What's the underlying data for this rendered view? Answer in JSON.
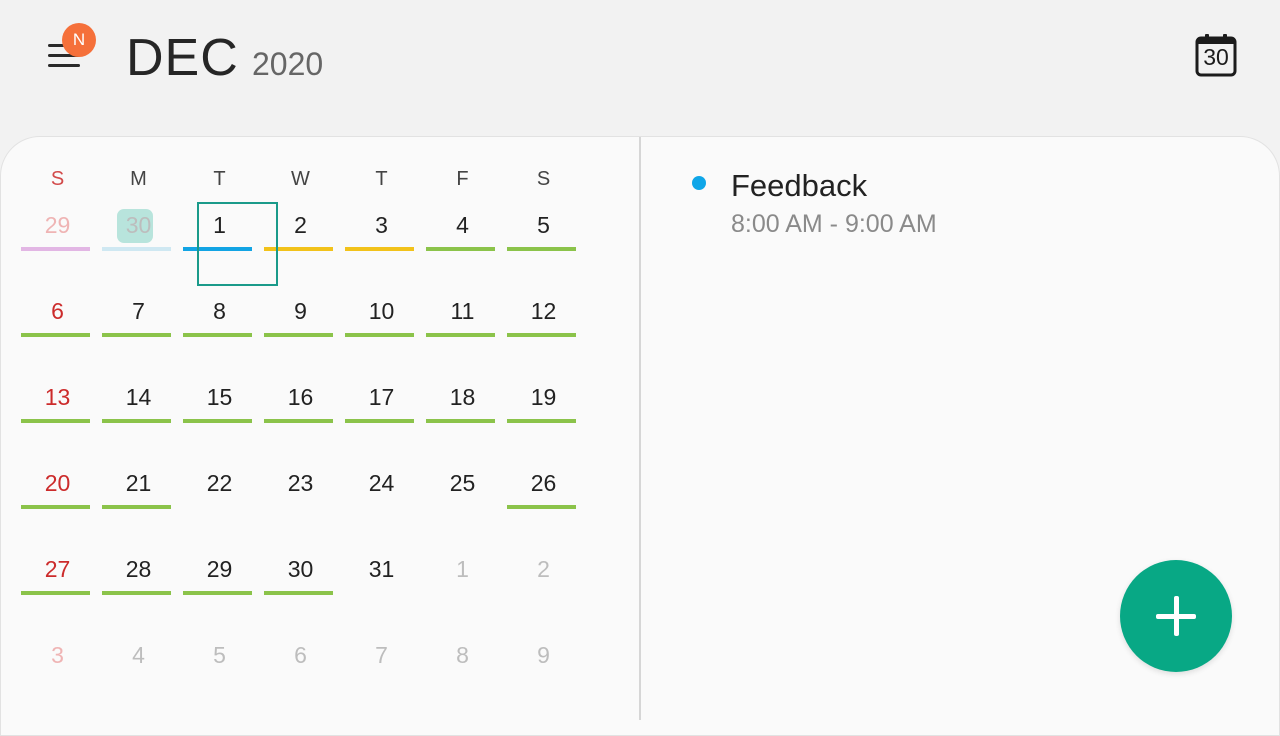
{
  "header": {
    "badge": "N",
    "month": "DEC",
    "year": "2020",
    "today_icon_number": "30"
  },
  "weekdays": [
    "S",
    "M",
    "T",
    "W",
    "T",
    "F",
    "S"
  ],
  "weeks": [
    [
      {
        "day": "29",
        "current": false,
        "event": "#e2b6e4"
      },
      {
        "day": "30",
        "current": false,
        "event": "#cfe8f2",
        "today": true
      },
      {
        "day": "1",
        "current": true,
        "event": "#12a4e4",
        "selected": true
      },
      {
        "day": "2",
        "current": true,
        "event": "#f2c21a"
      },
      {
        "day": "3",
        "current": true,
        "event": "#f2c21a"
      },
      {
        "day": "4",
        "current": true,
        "event": "#8bc34a"
      },
      {
        "day": "5",
        "current": true,
        "event": "#8bc34a"
      }
    ],
    [
      {
        "day": "6",
        "current": true,
        "event": "#8bc34a"
      },
      {
        "day": "7",
        "current": true,
        "event": "#8bc34a"
      },
      {
        "day": "8",
        "current": true,
        "event": "#8bc34a"
      },
      {
        "day": "9",
        "current": true,
        "event": "#8bc34a"
      },
      {
        "day": "10",
        "current": true,
        "event": "#8bc34a"
      },
      {
        "day": "11",
        "current": true,
        "event": "#8bc34a"
      },
      {
        "day": "12",
        "current": true,
        "event": "#8bc34a"
      }
    ],
    [
      {
        "day": "13",
        "current": true,
        "event": "#8bc34a"
      },
      {
        "day": "14",
        "current": true,
        "event": "#8bc34a"
      },
      {
        "day": "15",
        "current": true,
        "event": "#8bc34a"
      },
      {
        "day": "16",
        "current": true,
        "event": "#8bc34a"
      },
      {
        "day": "17",
        "current": true,
        "event": "#8bc34a"
      },
      {
        "day": "18",
        "current": true,
        "event": "#8bc34a"
      },
      {
        "day": "19",
        "current": true,
        "event": "#8bc34a"
      }
    ],
    [
      {
        "day": "20",
        "current": true,
        "event": "#8bc34a"
      },
      {
        "day": "21",
        "current": true,
        "event": "#8bc34a"
      },
      {
        "day": "22",
        "current": true,
        "event": null
      },
      {
        "day": "23",
        "current": true,
        "event": null
      },
      {
        "day": "24",
        "current": true,
        "event": null
      },
      {
        "day": "25",
        "current": true,
        "event": null
      },
      {
        "day": "26",
        "current": true,
        "event": "#8bc34a"
      }
    ],
    [
      {
        "day": "27",
        "current": true,
        "event": "#8bc34a"
      },
      {
        "day": "28",
        "current": true,
        "event": "#8bc34a"
      },
      {
        "day": "29",
        "current": true,
        "event": "#8bc34a"
      },
      {
        "day": "30",
        "current": true,
        "event": "#8bc34a"
      },
      {
        "day": "31",
        "current": true,
        "event": null
      },
      {
        "day": "1",
        "current": false,
        "event": null
      },
      {
        "day": "2",
        "current": false,
        "event": null
      }
    ],
    [
      {
        "day": "3",
        "current": false,
        "event": null
      },
      {
        "day": "4",
        "current": false,
        "event": null
      },
      {
        "day": "5",
        "current": false,
        "event": null
      },
      {
        "day": "6",
        "current": false,
        "event": null
      },
      {
        "day": "7",
        "current": false,
        "event": null
      },
      {
        "day": "8",
        "current": false,
        "event": null
      },
      {
        "day": "9",
        "current": false,
        "event": null
      }
    ]
  ],
  "events": [
    {
      "title": "Feedback",
      "time": "8:00 AM - 9:00 AM",
      "color": "#0fa6e8"
    }
  ],
  "fab": {
    "icon": "plus-icon",
    "color": "#08a885"
  },
  "colors": {
    "sunday": "#cc2b2b",
    "selection_border": "#1a9a8a",
    "today_fill": "#b8e4dc"
  }
}
